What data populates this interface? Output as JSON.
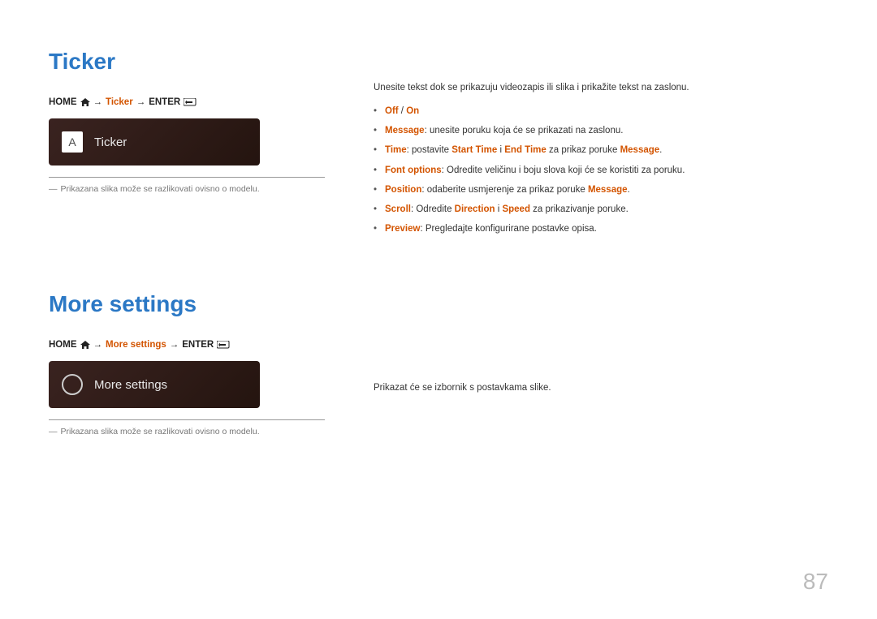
{
  "page_number": "87",
  "sections": {
    "ticker": {
      "heading": "Ticker",
      "breadcrumb": {
        "home": "HOME",
        "arrow1": "→",
        "mid": "Ticker",
        "arrow2": "→",
        "enter": "ENTER"
      },
      "tile": {
        "icon_letter": "A",
        "label": "Ticker"
      },
      "note": "Prikazana slika može se razlikovati ovisno o modelu.",
      "intro": "Unesite tekst dok se prikazuju videozapis ili slika i prikažite tekst na zaslonu.",
      "bullets": {
        "off_on": {
          "off": "Off",
          "slash": " / ",
          "on": "On"
        },
        "message": {
          "key": "Message",
          "text": ": unesite poruku koja će se prikazati na zaslonu."
        },
        "time": {
          "key": "Time",
          "t1": ": postavite ",
          "start": "Start Time",
          "and": " i ",
          "end": "End Time",
          "t2": " za prikaz poruke ",
          "msg": "Message",
          "dot": "."
        },
        "font": {
          "key": "Font options",
          "text": ": Odredite veličinu i boju slova koji će se koristiti za poruku."
        },
        "position": {
          "key": "Position",
          "t1": ": odaberite usmjerenje za prikaz poruke ",
          "msg": "Message",
          "dot": "."
        },
        "scroll": {
          "key": "Scroll",
          "t1": ": Odredite ",
          "dir": "Direction",
          "and": " i ",
          "spd": "Speed",
          "t2": " za prikazivanje poruke."
        },
        "preview": {
          "key": "Preview",
          "text": ": Pregledajte konfigurirane postavke opisa."
        }
      }
    },
    "more_settings": {
      "heading": "More settings",
      "breadcrumb": {
        "home": "HOME",
        "arrow1": "→",
        "mid": "More settings",
        "arrow2": "→",
        "enter": "ENTER"
      },
      "tile": {
        "label": "More settings"
      },
      "note": "Prikazana slika može se razlikovati ovisno o modelu.",
      "intro": "Prikazat će se izbornik s postavkama slike."
    }
  }
}
